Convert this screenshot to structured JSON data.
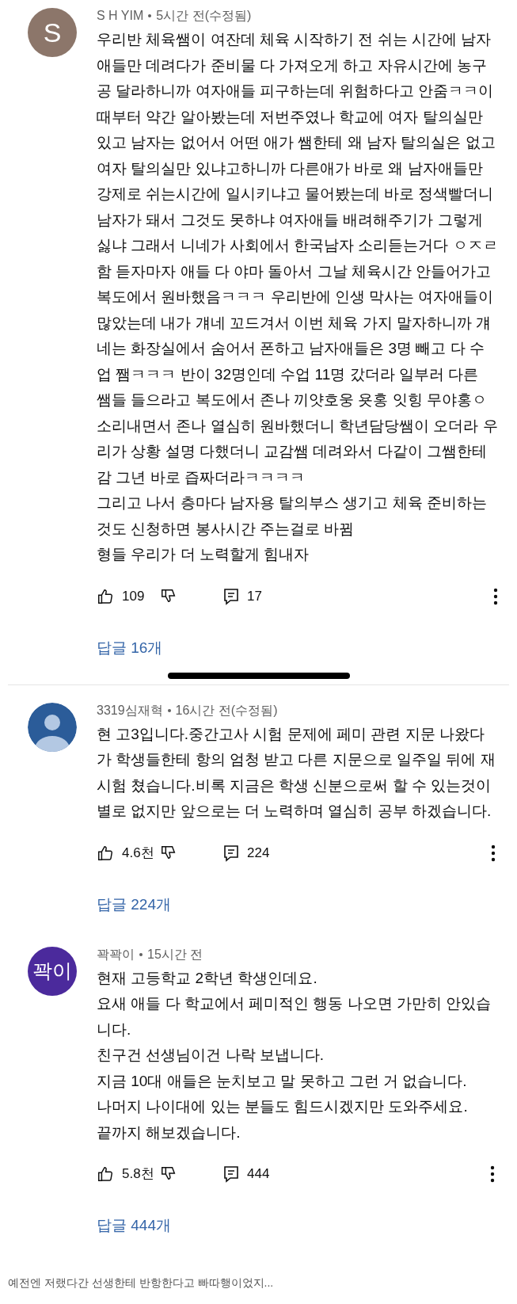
{
  "comments": [
    {
      "kind": "comment",
      "author": "S H YIM",
      "time": "5시간 전(수정됨)",
      "avatar": {
        "kind": "letter",
        "text": "S",
        "color": "#8c766a"
      },
      "lines": [
        "우리반 체육쌤이 여잔데 체육 시작하기 전 쉬는 시간에 남자",
        "애들만 데려다가  준비물 다 가져오게 하고 자유시간에 농구",
        "공 달라하니까 여자애들 피구하는데 위험하다고 안줌ㅋㅋ이",
        "때부터 약간 알아봤는데 저번주였나 학교에 여자 탈의실만",
        "있고 남자는 없어서 어떤 애가 쌤한테 왜 남자 탈의실은 없고",
        "여자 탈의실만 있냐고하니까 다른애가 바로 왜 남자애들만",
        "강제로 쉬는시간에 일시키냐고 물어봤는데 바로 정색빨더니",
        "남자가 돼서 그것도 못하냐 여자애들 배려해주기가 그렇게",
        "싫냐 그래서 니네가 사회에서 한국남자 소리듣는거다 ㅇㅈㄹ",
        "함 듣자마자 애들 다 야마 돌아서 그날 체육시간 안들어가고",
        "복도에서 원바했음ㅋㅋㅋ 우리반에 인생 막사는 여자애들이",
        "많았는데 내가 걔네 꼬드겨서 이번 체육 가지 말자하니까 걔",
        "네는 화장실에서 숨어서 폰하고 남자애들은 3명 빼고 다 수",
        "업 쨈ㅋㅋㅋ 반이 32명인데 수업 11명 갔더라 일부러 다른",
        "쌤들 들으라고 복도에서 존나 끼얏호웅 욧홍 잇힝 무야홍ㅇ",
        "소리내면서 존나 열심히 원바했더니 학년담당쌤이 오더라 우",
        "리가 상황 설명 다했더니 교감쌤 데려와서 다같이 그쌤한테",
        "감 그년 바로 즙짜더라ㅋㅋㅋㅋ",
        "그리고 나서 층마다 남자용 탈의부스 생기고 체육 준비하는",
        "것도 신청하면 봉사시간 주는걸로 바뀜",
        "형들 우리가 더 노력할게 힘내자"
      ],
      "likes": "109",
      "replies_count": "17",
      "replies_link": "답글 16개"
    },
    {
      "kind": "screen_break"
    },
    {
      "kind": "comment",
      "author": "3319심재혁",
      "time": "16시간 전(수정됨)",
      "avatar": {
        "kind": "default",
        "color": "#2b5c99"
      },
      "lines": [
        "현 고3입니다.중간고사 시험 문제에 페미 관련 지문 나왔다",
        "가 학생들한테 항의 엄청 받고 다른 지문으로 일주일 뒤에 재",
        "시험 쳤습니다.비록 지금은 학생 신분으로써 할 수 있는것이",
        "별로 없지만 앞으로는 더 노력하며 열심히 공부 하겠습니다."
      ],
      "likes": "4.6천",
      "replies_count": "224",
      "replies_link": "답글 224개"
    },
    {
      "kind": "comment",
      "author": "꽉꽉이",
      "time": "15시간 전",
      "avatar": {
        "kind": "letter",
        "text": "꽉이",
        "color": "#4b2a9c"
      },
      "lines": [
        "현재 고등학교 2학년 학생인데요.",
        "요새 애들 다 학교에서 페미적인 행동 나오면 가만히 안있습",
        "니다.",
        "친구건 선생님이건 나락 보냅니다.",
        "지금 10대 애들은 눈치보고 말 못하고 그런 거 없습니다.",
        "나머지 나이대에 있는 분들도 힘드시겠지만 도와주세요.",
        "끝까지 해보겠습니다."
      ],
      "likes": "5.8천",
      "replies_count": "444",
      "replies_link": "답글 444개"
    }
  ],
  "caption": "예전엔 저랬다간 선생한테 반항한다고 빠따행이었지..."
}
